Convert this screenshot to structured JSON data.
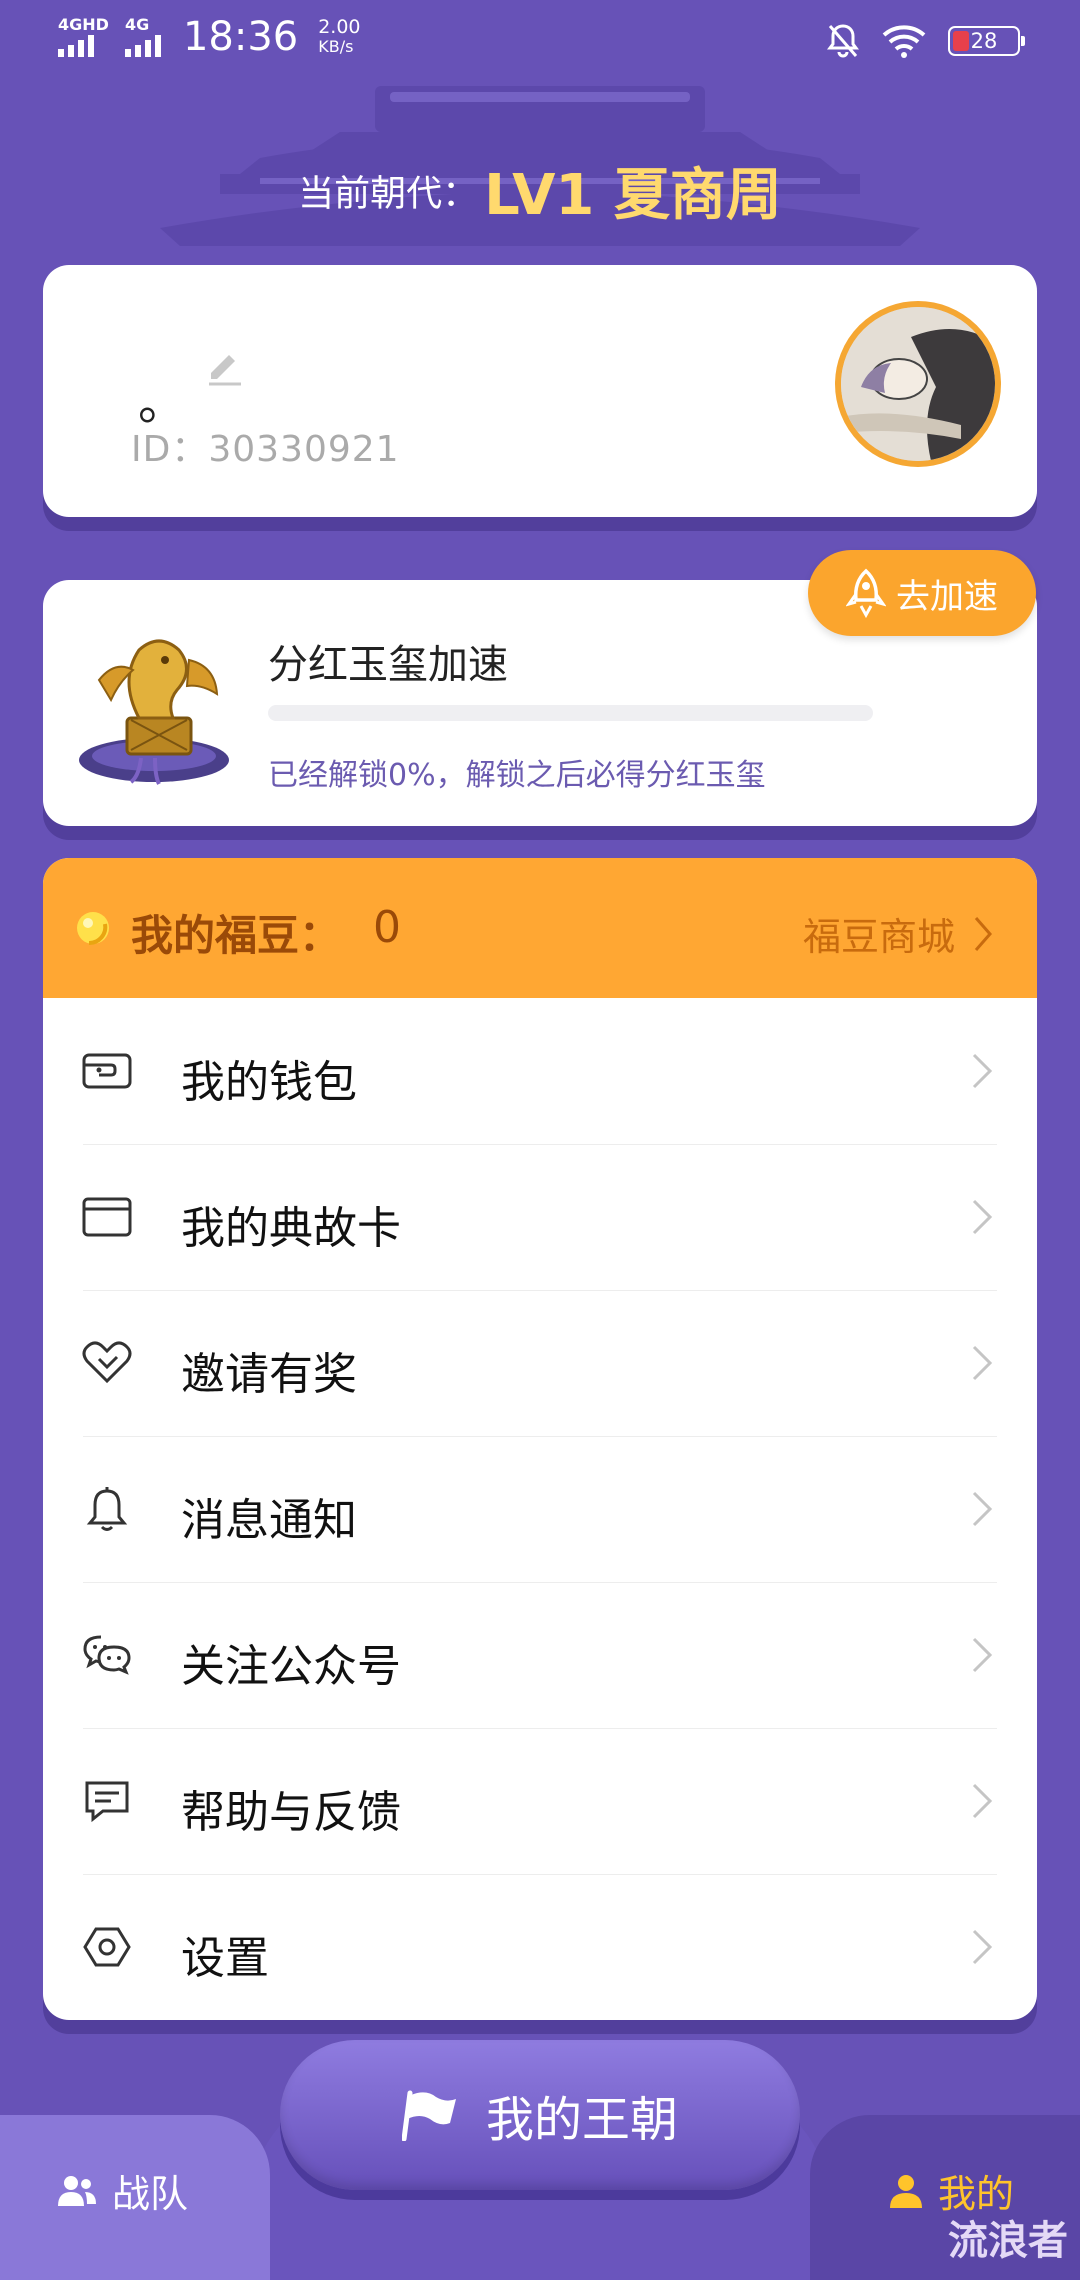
{
  "status_bar": {
    "network1": "4GHD",
    "network2": "4G",
    "time": "18:36",
    "speed_value": "2.00",
    "speed_unit": "KB/s",
    "battery": "28"
  },
  "header": {
    "prefix": "当前朝代：",
    "level": "LV1 夏商周"
  },
  "profile": {
    "nickname": "。",
    "id_text": "ID：30330921"
  },
  "speedup": {
    "title": "分红玉玺加速",
    "progress": 0,
    "desc": "已经解锁0%，解锁之后必得分红玉玺",
    "button": "去加速"
  },
  "beans": {
    "label": "我的福豆：",
    "value": "0",
    "mall": "福豆商城"
  },
  "menu": {
    "items": [
      {
        "label": "我的钱包",
        "icon": "wallet-icon"
      },
      {
        "label": "我的典故卡",
        "icon": "card-icon"
      },
      {
        "label": "邀请有奖",
        "icon": "heart-icon"
      },
      {
        "label": "消息通知",
        "icon": "bell-icon"
      },
      {
        "label": "关注公众号",
        "icon": "wechat-icon"
      },
      {
        "label": "帮助与反馈",
        "icon": "feedback-icon"
      },
      {
        "label": "设置",
        "icon": "settings-icon"
      }
    ]
  },
  "nav": {
    "team": "战队",
    "dynasty": "我的王朝",
    "mine": "我的"
  },
  "watermark": "流浪者",
  "colors": {
    "background": "#6752b7",
    "accent_orange": "#ffa733",
    "level_gold": "#ffd96e",
    "nav_active": "#ffc42b"
  }
}
